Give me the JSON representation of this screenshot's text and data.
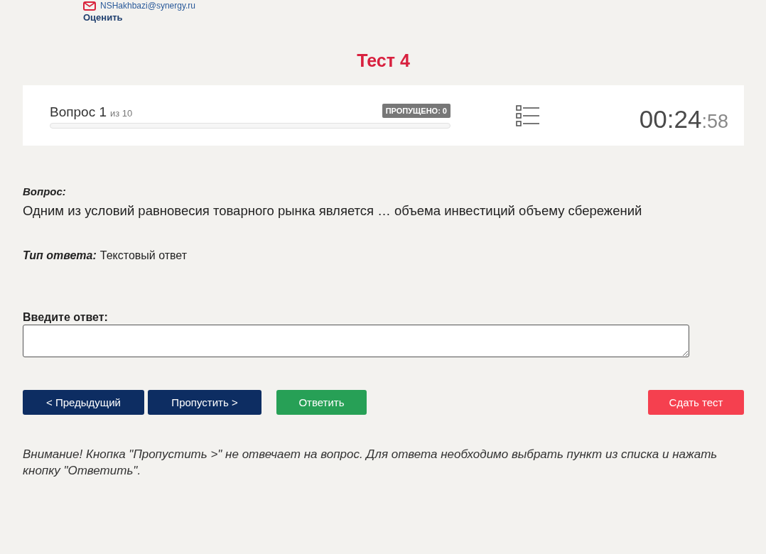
{
  "user": {
    "email": "NSHakhbazi@synergy.ru",
    "rate_link": "Оценить"
  },
  "title": "Тест 4",
  "header": {
    "question_label": "Вопрос 1",
    "question_total": "из 10",
    "skipped_badge": "ПРОПУЩЕНО: 0",
    "timer": {
      "main": "00:24",
      "seconds": ":58"
    }
  },
  "question": {
    "label": "Вопрос:",
    "text": "Одним из условий равновесия товарного рынка является … объема инвестиций объему сбережений"
  },
  "answer_type": {
    "label": "Тип ответа:",
    "value": "Текстовый ответ"
  },
  "answer": {
    "label": "Введите ответ:"
  },
  "buttons": [
    {
      "label": "< Предыдущий",
      "kind": "nav"
    },
    {
      "label": "Пропустить >",
      "kind": "nav"
    },
    {
      "label": "Ответить",
      "kind": "answer"
    },
    {
      "label": "Сдать тест",
      "kind": "submit"
    }
  ],
  "note": "Внимание! Кнопка \"Пропустить >\" не отвечает на вопрос. Для ответа необходимо выбрать пункт из списка и нажать кнопку \"Ответить\"."
}
